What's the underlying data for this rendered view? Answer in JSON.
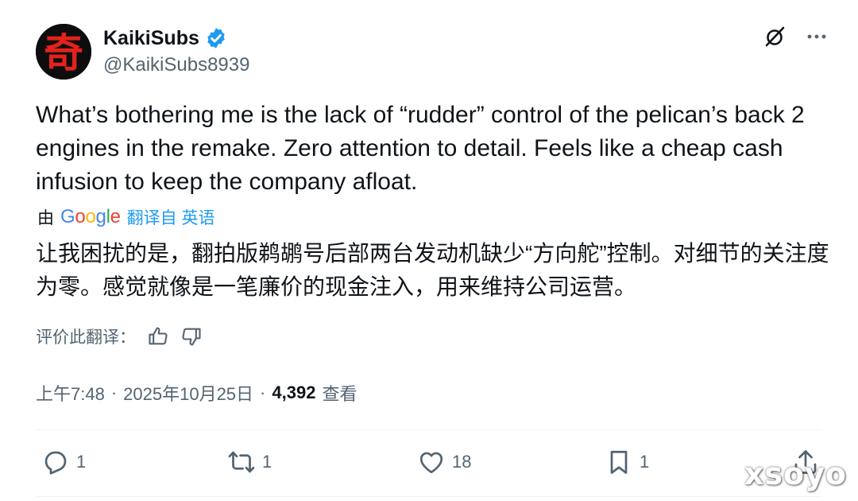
{
  "author": {
    "display_name": "KaikiSubs",
    "handle": "@KaikiSubs8939",
    "avatar_glyph": "奇",
    "avatar_bg": "#0d0d0d",
    "avatar_fg": "#e4221b",
    "verified": true,
    "verified_color": "#1d9bf0"
  },
  "tweet": {
    "text": "What’s bothering me is the lack of “rudder” control of the pelican’s back 2 engines in the remake. Zero attention to detail. Feels like a cheap cash infusion to keep the company afloat."
  },
  "translation": {
    "prefix": "由",
    "provider_letters": [
      "G",
      "o",
      "o",
      "g",
      "l",
      "e"
    ],
    "link_label": "翻译自 英语",
    "text": "让我困扰的是，翻拍版鹈鹕号后部两台发动机缺少“方向舵”控制。对细节的关注度为零。感觉就像是一笔廉价的现金注入，用来维持公司运营。",
    "rate_label": "评价此翻译："
  },
  "meta": {
    "time": "上午7:48",
    "sep1": "·",
    "date": "2025年10月25日",
    "sep2": "·",
    "views_count": "4,392",
    "views_label": "查看"
  },
  "actions": {
    "replies": "1",
    "reposts": "1",
    "likes": "18",
    "bookmarks": "1"
  },
  "icons": {
    "top_right": [
      "grok-icon",
      "more-icon"
    ],
    "rating": [
      "thumbs-up-icon",
      "thumbs-down-icon"
    ],
    "bar": [
      "reply-icon",
      "repost-icon",
      "like-icon",
      "bookmark-icon",
      "share-icon"
    ]
  },
  "colors": {
    "text_primary": "#0f1419",
    "text_secondary": "#536471",
    "link": "#1d9bf0"
  },
  "watermark": "xsoyo"
}
